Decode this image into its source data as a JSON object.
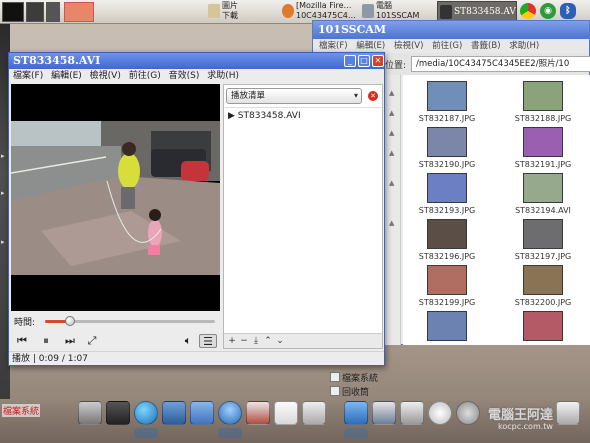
{
  "top_panel": {
    "task_folder": "圖片\n下載",
    "task_browser": "[Mozilla Fire…\n10C43475C4…",
    "task_computer": "電腦\n101SSCAM",
    "task_player": "ST833458.AVI",
    "tray_icons": [
      "chrome-icon",
      "wifi-icon",
      "bluetooth-icon"
    ]
  },
  "file_manager": {
    "title": "101SSCAM",
    "menu": [
      "檔案(F)",
      "編輯(E)",
      "檢視(V)",
      "前往(G)",
      "書籤(B)",
      "求助(H)"
    ],
    "location_label": "位置:",
    "location": "/media/10C43475C4345EE2/照片/10",
    "files": [
      {
        "name": "ST832187.JPG",
        "color": "#6f8fb8"
      },
      {
        "name": "ST832188.JPG",
        "color": "#8aa37a"
      },
      {
        "name": "ST832190.JPG",
        "color": "#7b86a8"
      },
      {
        "name": "ST832191.JPG",
        "color": "#9a5fb0"
      },
      {
        "name": "ST832193.JPG",
        "color": "#6b7fc2"
      },
      {
        "name": "ST832194.AVI",
        "color": "#97a98c"
      },
      {
        "name": "ST832196.JPG",
        "color": "#5b4e46"
      },
      {
        "name": "ST832197.JPG",
        "color": "#6d6d70"
      },
      {
        "name": "ST832199.JPG",
        "color": "#b06e62"
      },
      {
        "name": "ST832200.JPG",
        "color": "#8a7355"
      },
      {
        "name": "",
        "color": "#6c82b0"
      },
      {
        "name": "",
        "color": "#b45a66"
      }
    ]
  },
  "player": {
    "title": "ST833458.AVI",
    "menu": [
      "檔案(F)",
      "編輯(E)",
      "檢視(V)",
      "前往(G)",
      "音效(S)",
      "求助(H)"
    ],
    "playlist_combo": "播放清單",
    "playlist_entry": "ST833458.AVI",
    "time_label": "時間:",
    "progress": 0.146,
    "status": "播放 | 0:09 / 1:07",
    "volume_icon": "speaker-icon"
  },
  "desktop": {
    "items": [
      "檔案系統",
      "回收筒"
    ],
    "dock_label": "檔案系統"
  },
  "watermark": {
    "text": "電腦王阿達",
    "sub": "kocpc.com.tw"
  }
}
